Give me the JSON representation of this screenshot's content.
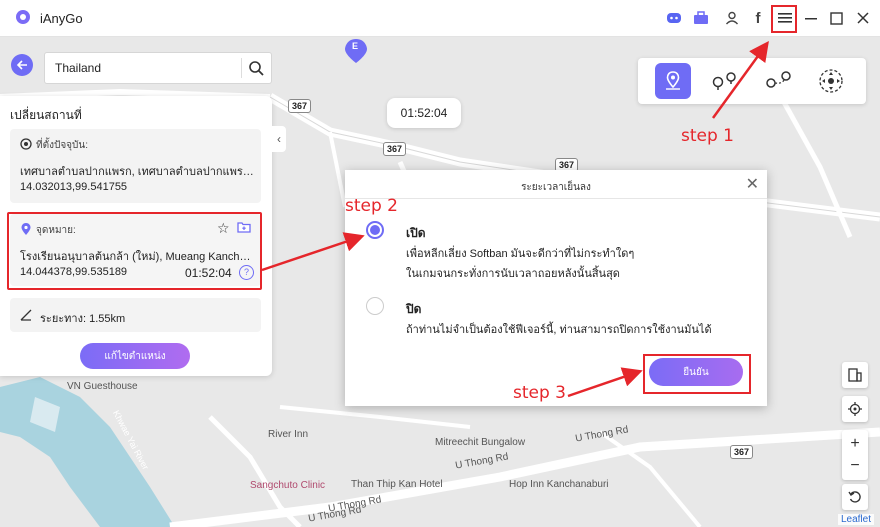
{
  "app": {
    "title": "iAnyGo"
  },
  "search": {
    "value": "Thailand",
    "placeholder": ""
  },
  "panel": {
    "title": "เปลี่ยนสถานที่",
    "current": {
      "label": "ที่ตั้งปัจจุบัน:",
      "address": "เทศบาลตำบลปากแพรก, เทศบาลตำบลปากแพรก, Mueang Kanchanaburi",
      "coords": "14.032013,99.541755"
    },
    "destination": {
      "label": "จุดหมาย:",
      "address": "โรงเรียนอนุบาลต้นกล้า (ใหม่), Mueang Kanchanaburi",
      "coords": "14.044378,99.535189",
      "time": "01:52:04"
    },
    "distance": "ระยะทาง: 1.55km",
    "modify_button": "แก้ไขตำแหน่ง"
  },
  "timer": "01:52:04",
  "map": {
    "labels": [
      "VN Guesthouse",
      "River Inn",
      "Mitreechit Bungalow",
      "Sangchuto Clinic",
      "Than Thip Kan Hotel",
      "Hop Inn Kanchanaburi",
      "Khwae Yai River"
    ],
    "roads": [
      "U Thong Rd",
      "U Thong Rd",
      "U Thong Rd",
      "U Thong Rd"
    ],
    "shields": [
      "367",
      "367",
      "367",
      "367"
    ],
    "attribution": "Leaflet"
  },
  "dialog": {
    "title": "ระยะเวลาเย็นลง",
    "option_on": {
      "title": "เปิด",
      "desc1": "เพื่อหลีกเลี่ยง Softban มันจะดีกว่าที่ไม่กระทำใดๆ",
      "desc2": "ในเกมจนกระทั่งการนับเวลาถอยหลังนั้นสิ้นสุด"
    },
    "option_off": {
      "title": "ปิด",
      "desc1": "ถ้าท่านไม่จำเป็นต้องใช้ฟีเจอร์นี้, ท่านสามารถปิดการใช้งานมันได้"
    },
    "confirm": "ยืนยัน"
  },
  "annotations": {
    "step1": "step 1",
    "step2": "step 2",
    "step3": "step 3"
  },
  "colors": {
    "accent": "#6f6cf5",
    "annotation": "#e5262b"
  }
}
